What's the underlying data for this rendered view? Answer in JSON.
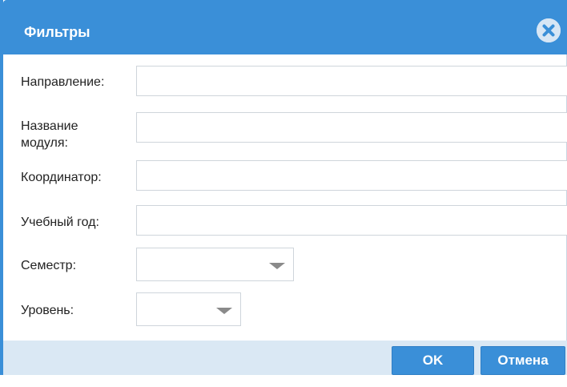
{
  "dialog": {
    "title": "Фильтры",
    "close_icon": "close-circle-icon"
  },
  "fields": {
    "direction": {
      "label": "Направление:",
      "value": ""
    },
    "module_name": {
      "label_line1": "Название",
      "label_line2": "модуля:",
      "value": ""
    },
    "coordinator": {
      "label": "Координатор:",
      "value": ""
    },
    "academic_year": {
      "label": "Учебный год:",
      "value": ""
    },
    "semester": {
      "label": "Семестр:",
      "selected": ""
    },
    "level": {
      "label": "Уровень:",
      "selected": ""
    }
  },
  "buttons": {
    "ok": "OK",
    "cancel": "Отмена"
  },
  "colors": {
    "accent": "#3a8fd8",
    "footer_bg": "#dae8f4"
  }
}
